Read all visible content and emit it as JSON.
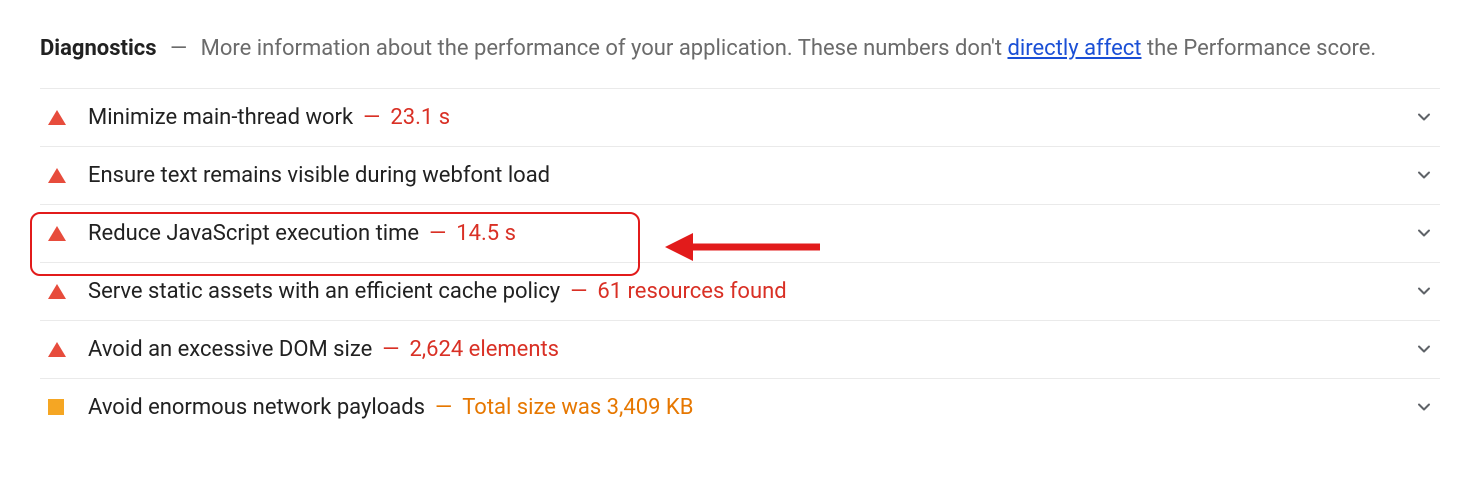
{
  "header": {
    "title": "Diagnostics",
    "dash": "—",
    "desc_before": "More information about the performance of your application. These numbers don't ",
    "link_text": "directly affect",
    "desc_after": " the Performance score."
  },
  "rows": [
    {
      "icon": "triangle-red",
      "label": "Minimize main-thread work",
      "dash": "—",
      "metric": "23.1 s",
      "metric_color": "red"
    },
    {
      "icon": "triangle-red",
      "label": "Ensure text remains visible during webfont load",
      "dash": "",
      "metric": "",
      "metric_color": "red"
    },
    {
      "icon": "triangle-red",
      "label": "Reduce JavaScript execution time",
      "dash": "—",
      "metric": "14.5 s",
      "metric_color": "red"
    },
    {
      "icon": "triangle-red",
      "label": "Serve static assets with an efficient cache policy",
      "dash": "—",
      "metric": "61 resources found",
      "metric_color": "red"
    },
    {
      "icon": "triangle-red",
      "label": "Avoid an excessive DOM size",
      "dash": "—",
      "metric": "2,624 elements",
      "metric_color": "red"
    },
    {
      "icon": "square-orange",
      "label": "Avoid enormous network payloads",
      "dash": "—",
      "metric": "Total size was 3,409 KB",
      "metric_color": "orange"
    }
  ]
}
